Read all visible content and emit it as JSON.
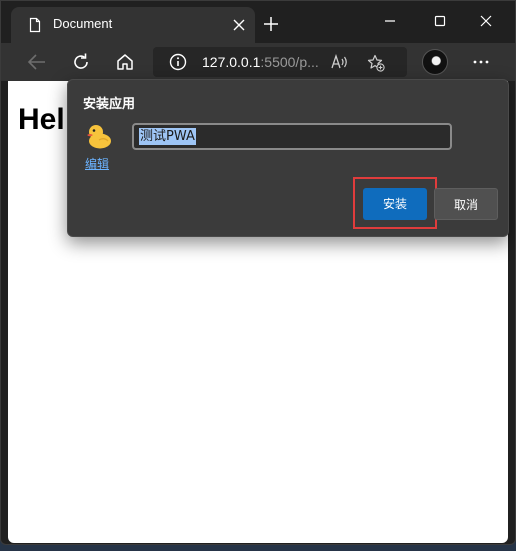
{
  "tab": {
    "title": "Document"
  },
  "addressbar": {
    "host": "127.0.0.1",
    "rest": ":5500/p..."
  },
  "page": {
    "heading": "Hel"
  },
  "dialog": {
    "title": "安装应用",
    "edit_label": "编辑",
    "app_name_value": "测试PWA",
    "install_label": "安装",
    "cancel_label": "取消"
  },
  "colors": {
    "accent": "#0f6cbd",
    "highlight": "#e03c3c",
    "dialog_bg": "#3b3b3b",
    "toolbar_bg": "#333333"
  },
  "icons": {
    "tab": "document-icon",
    "close": "close-icon",
    "new_tab": "plus-icon",
    "back": "back-arrow-icon",
    "refresh": "refresh-icon",
    "home": "home-icon",
    "info": "info-icon",
    "read_aloud": "read-aloud-icon",
    "favorites": "add-favorite-icon",
    "more": "more-icon",
    "app": "duck-icon"
  }
}
